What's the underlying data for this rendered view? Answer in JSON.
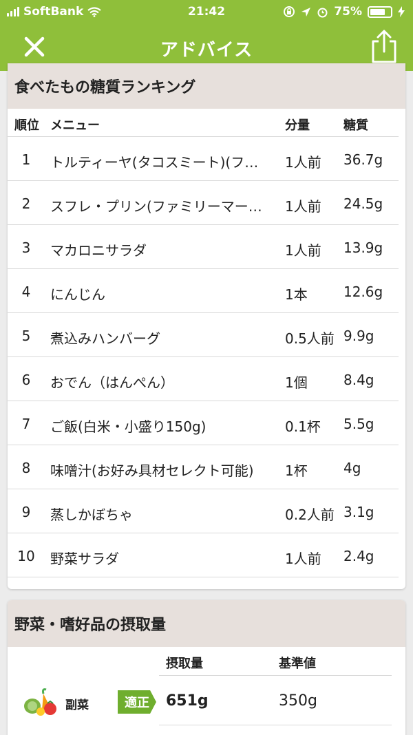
{
  "status_bar": {
    "carrier": "SoftBank",
    "time": "21:42",
    "battery": "75%",
    "battery_level": 0.75
  },
  "nav": {
    "title": "アドバイス"
  },
  "ranking": {
    "title": "食べたもの糖質ランキング",
    "headers": {
      "rank": "順位",
      "menu": "メニュー",
      "qty": "分量",
      "carb": "糖質"
    },
    "rows": [
      {
        "rank": "1",
        "menu": "トルティーヤ(タコスミート)(フ…",
        "qty": "1人前",
        "carb": "36.7g"
      },
      {
        "rank": "2",
        "menu": "スフレ・プリン(ファミリーマー…",
        "qty": "1人前",
        "carb": "24.5g"
      },
      {
        "rank": "3",
        "menu": "マカロニサラダ",
        "qty": "1人前",
        "carb": "13.9g"
      },
      {
        "rank": "4",
        "menu": "にんじん",
        "qty": "1本",
        "carb": "12.6g"
      },
      {
        "rank": "5",
        "menu": "煮込みハンバーグ",
        "qty": "0.5人前",
        "carb": "9.9g"
      },
      {
        "rank": "6",
        "menu": "おでん（はんぺん）",
        "qty": "1個",
        "carb": "8.4g"
      },
      {
        "rank": "7",
        "menu": "ご飯(白米・小盛り150g)",
        "qty": "0.1杯",
        "carb": "5.5g"
      },
      {
        "rank": "8",
        "menu": "味噌汁(お好み具材セレクト可能)",
        "qty": "1杯",
        "carb": "4g"
      },
      {
        "rank": "9",
        "menu": "蒸しかぼちゃ",
        "qty": "0.2人前",
        "carb": "3.1g"
      },
      {
        "rank": "10",
        "menu": "野菜サラダ",
        "qty": "1人前",
        "carb": "2.4g"
      }
    ]
  },
  "intake": {
    "title": "野菜・嗜好品の摂取量",
    "headers": {
      "amount": "摂取量",
      "standard": "基準値"
    },
    "rows": [
      {
        "label": "副菜",
        "badge": "適正",
        "amount": "651g",
        "standard": "350g",
        "icon": "vegetables-icon"
      }
    ]
  },
  "colors": {
    "accent": "#8fbf3a",
    "badge": "#6fae2e",
    "section_header": "#e7e0dc"
  }
}
